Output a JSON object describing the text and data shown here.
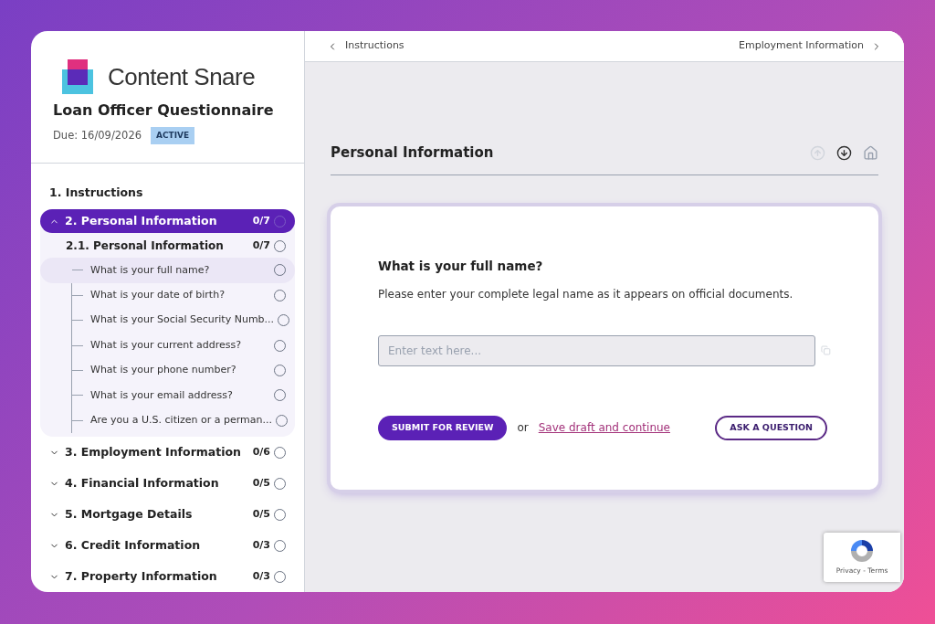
{
  "brand": {
    "name": "Content Snare"
  },
  "questionnaire": {
    "title": "Loan Officer Questionnaire",
    "due": "Due: 16/09/2026",
    "status": "ACTIVE"
  },
  "sections": [
    {
      "label": "1. Instructions",
      "kind": "plain",
      "selected": false
    },
    {
      "label": "2. Personal Information",
      "kind": "group",
      "selected": true,
      "expanded": true,
      "count": "0/7",
      "children": [
        {
          "label": "2.1. Personal Information",
          "count": "0/7",
          "questions": [
            {
              "label": "What is your full name?",
              "selected": true
            },
            {
              "label": "What is your date of birth?",
              "selected": false
            },
            {
              "label": "What is your Social Security Numb...",
              "selected": false
            },
            {
              "label": "What is your current address?",
              "selected": false
            },
            {
              "label": "What is your phone number?",
              "selected": false
            },
            {
              "label": "What is your email address?",
              "selected": false
            },
            {
              "label": "Are you a U.S. citizen or a perman...",
              "selected": false
            }
          ]
        }
      ]
    },
    {
      "label": "3. Employment Information",
      "kind": "group",
      "selected": false,
      "expanded": false,
      "count": "0/6"
    },
    {
      "label": "4. Financial Information",
      "kind": "group",
      "selected": false,
      "expanded": false,
      "count": "0/5"
    },
    {
      "label": "5. Mortgage Details",
      "kind": "group",
      "selected": false,
      "expanded": false,
      "count": "0/5"
    },
    {
      "label": "6. Credit Information",
      "kind": "group",
      "selected": false,
      "expanded": false,
      "count": "0/3"
    },
    {
      "label": "7. Property Information",
      "kind": "group",
      "selected": false,
      "expanded": false,
      "count": "0/3"
    }
  ],
  "nav": {
    "previous": "Instructions",
    "next": "Employment Information"
  },
  "page": {
    "title": "Personal Information"
  },
  "question": {
    "title": "What is your full name?",
    "description": "Please enter your complete legal name as it appears on official documents.",
    "placeholder": "Enter text here...",
    "submit": "SUBMIT FOR REVIEW",
    "or": "or",
    "save": "Save draft and continue",
    "ask": "ASK A QUESTION"
  },
  "recaptcha": {
    "links": "Privacy - Terms"
  }
}
